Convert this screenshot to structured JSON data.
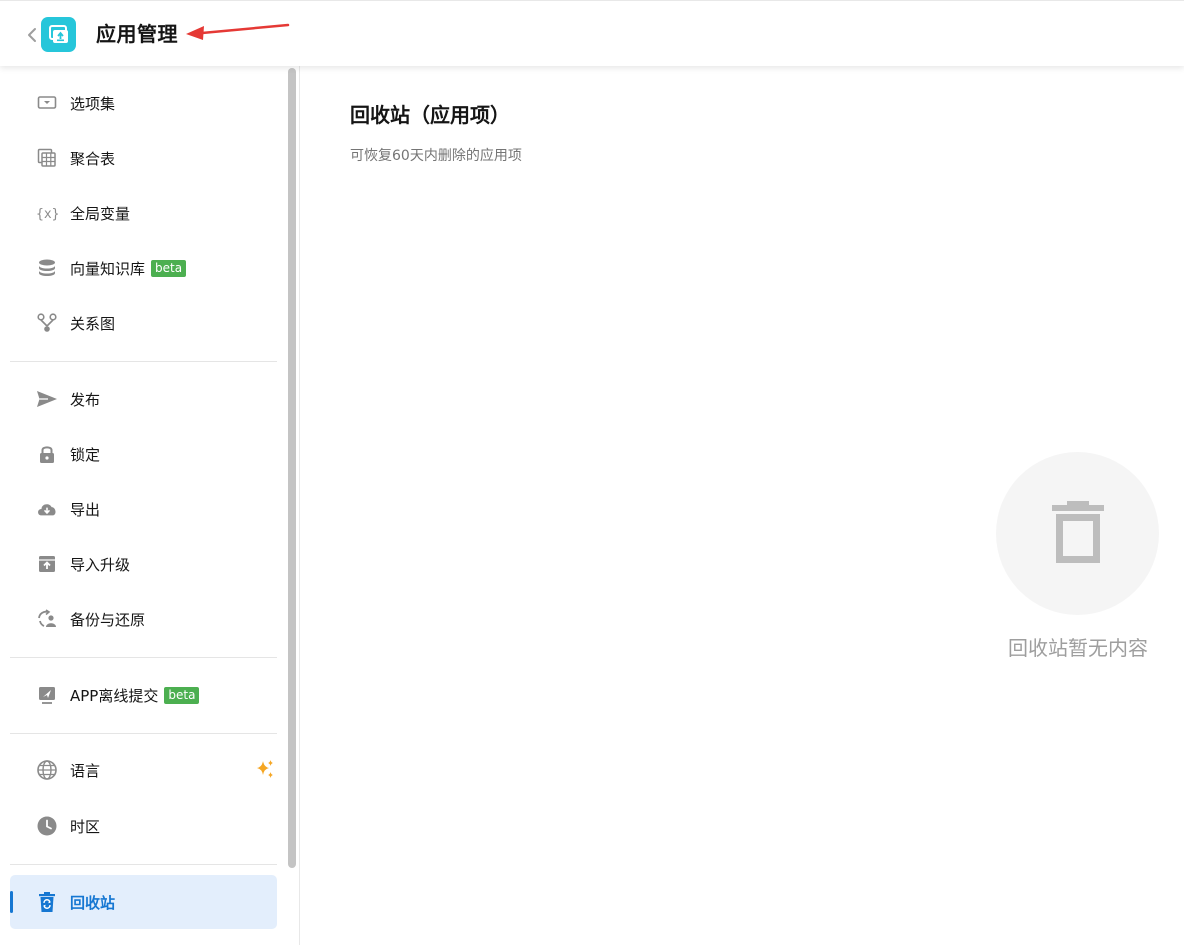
{
  "header": {
    "title": "应用管理",
    "app_icon": "app-manage-icon",
    "accent_color": "#26c6da",
    "annotation_color": "#e53935"
  },
  "sidebar": {
    "groups": [
      [
        {
          "label": "选项集",
          "icon": "option-set-icon"
        },
        {
          "label": "聚合表",
          "icon": "aggregate-table-icon"
        },
        {
          "label": "全局变量",
          "icon": "global-variable-icon"
        },
        {
          "label": "向量知识库",
          "icon": "database-icon",
          "badge": "beta"
        },
        {
          "label": "关系图",
          "icon": "relation-graph-icon"
        }
      ],
      [
        {
          "label": "发布",
          "icon": "send-icon"
        },
        {
          "label": "锁定",
          "icon": "lock-icon"
        },
        {
          "label": "导出",
          "icon": "cloud-download-icon"
        },
        {
          "label": "导入升级",
          "icon": "import-upgrade-icon"
        },
        {
          "label": "备份与还原",
          "icon": "backup-restore-icon"
        }
      ],
      [
        {
          "label": "APP离线提交",
          "icon": "offline-submit-icon",
          "badge": "beta"
        }
      ],
      [
        {
          "label": "语言",
          "icon": "globe-icon",
          "extra_icon": "sparkle-icon"
        },
        {
          "label": "时区",
          "icon": "clock-icon"
        }
      ],
      [
        {
          "label": "回收站",
          "icon": "recycle-bin-icon",
          "active": true
        }
      ]
    ],
    "badge_color": "#4caf50",
    "active_color": "#1677d2"
  },
  "main": {
    "title": "回收站（应用项）",
    "subtitle": "可恢复60天内删除的应用项",
    "empty_text": "回收站暂无内容",
    "empty_icon": "trash-icon"
  }
}
